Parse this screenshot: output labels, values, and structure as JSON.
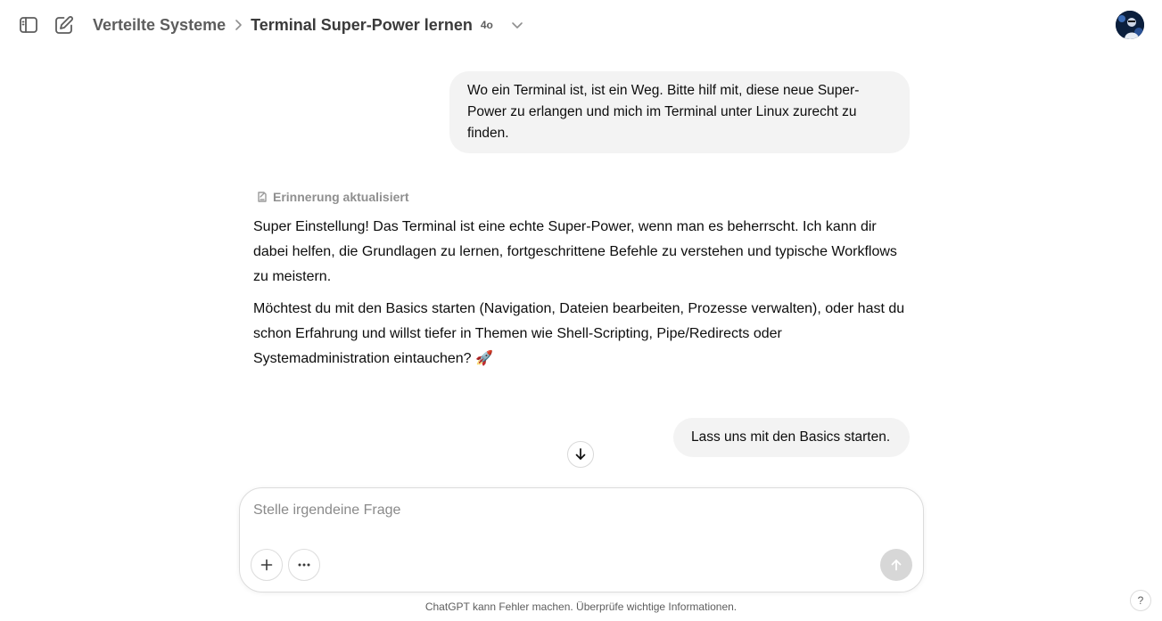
{
  "header": {
    "project": "Verteilte Systeme",
    "chat_title": "Terminal Super-Power lernen",
    "model_badge": "4o"
  },
  "messages": {
    "user_1": "Wo ein Terminal ist, ist ein Weg. Bitte hilf mit, diese neue Super-Power zu erlangen und mich im Terminal unter Linux zurecht zu finden.",
    "memory_status": "Erinnerung aktualisiert",
    "assistant_p1": "Super Einstellung! Das Terminal ist eine echte Super-Power, wenn man es beherrscht. Ich kann dir dabei helfen, die Grundlagen zu lernen, fortgeschrittene Befehle zu verstehen und typische Workflows zu meistern.",
    "assistant_p2": "Möchtest du mit den Basics starten (Navigation, Dateien bearbeiten, Prozesse verwalten), oder hast du schon Erfahrung und willst tiefer in Themen wie Shell-Scripting, Pipe/Redirects oder Systemadministration eintauchen? 🚀",
    "user_2": "Lass uns mit den Basics starten."
  },
  "composer": {
    "placeholder": "Stelle irgendeine Frage"
  },
  "footer": {
    "disclaimer": "ChatGPT kann Fehler machen. Überprüfe wichtige Informationen.",
    "help_label": "?"
  },
  "icons": [
    "sidebar-toggle-icon",
    "new-chat-icon",
    "chevron-right-icon",
    "chevron-down-icon",
    "memory-icon",
    "arrow-down-icon",
    "plus-icon",
    "more-icon",
    "send-arrow-icon"
  ],
  "colors": {
    "user_bubble": "#f3f3f3",
    "send_disabled": "#d7d7d7",
    "muted_text": "#8f8f8f"
  }
}
